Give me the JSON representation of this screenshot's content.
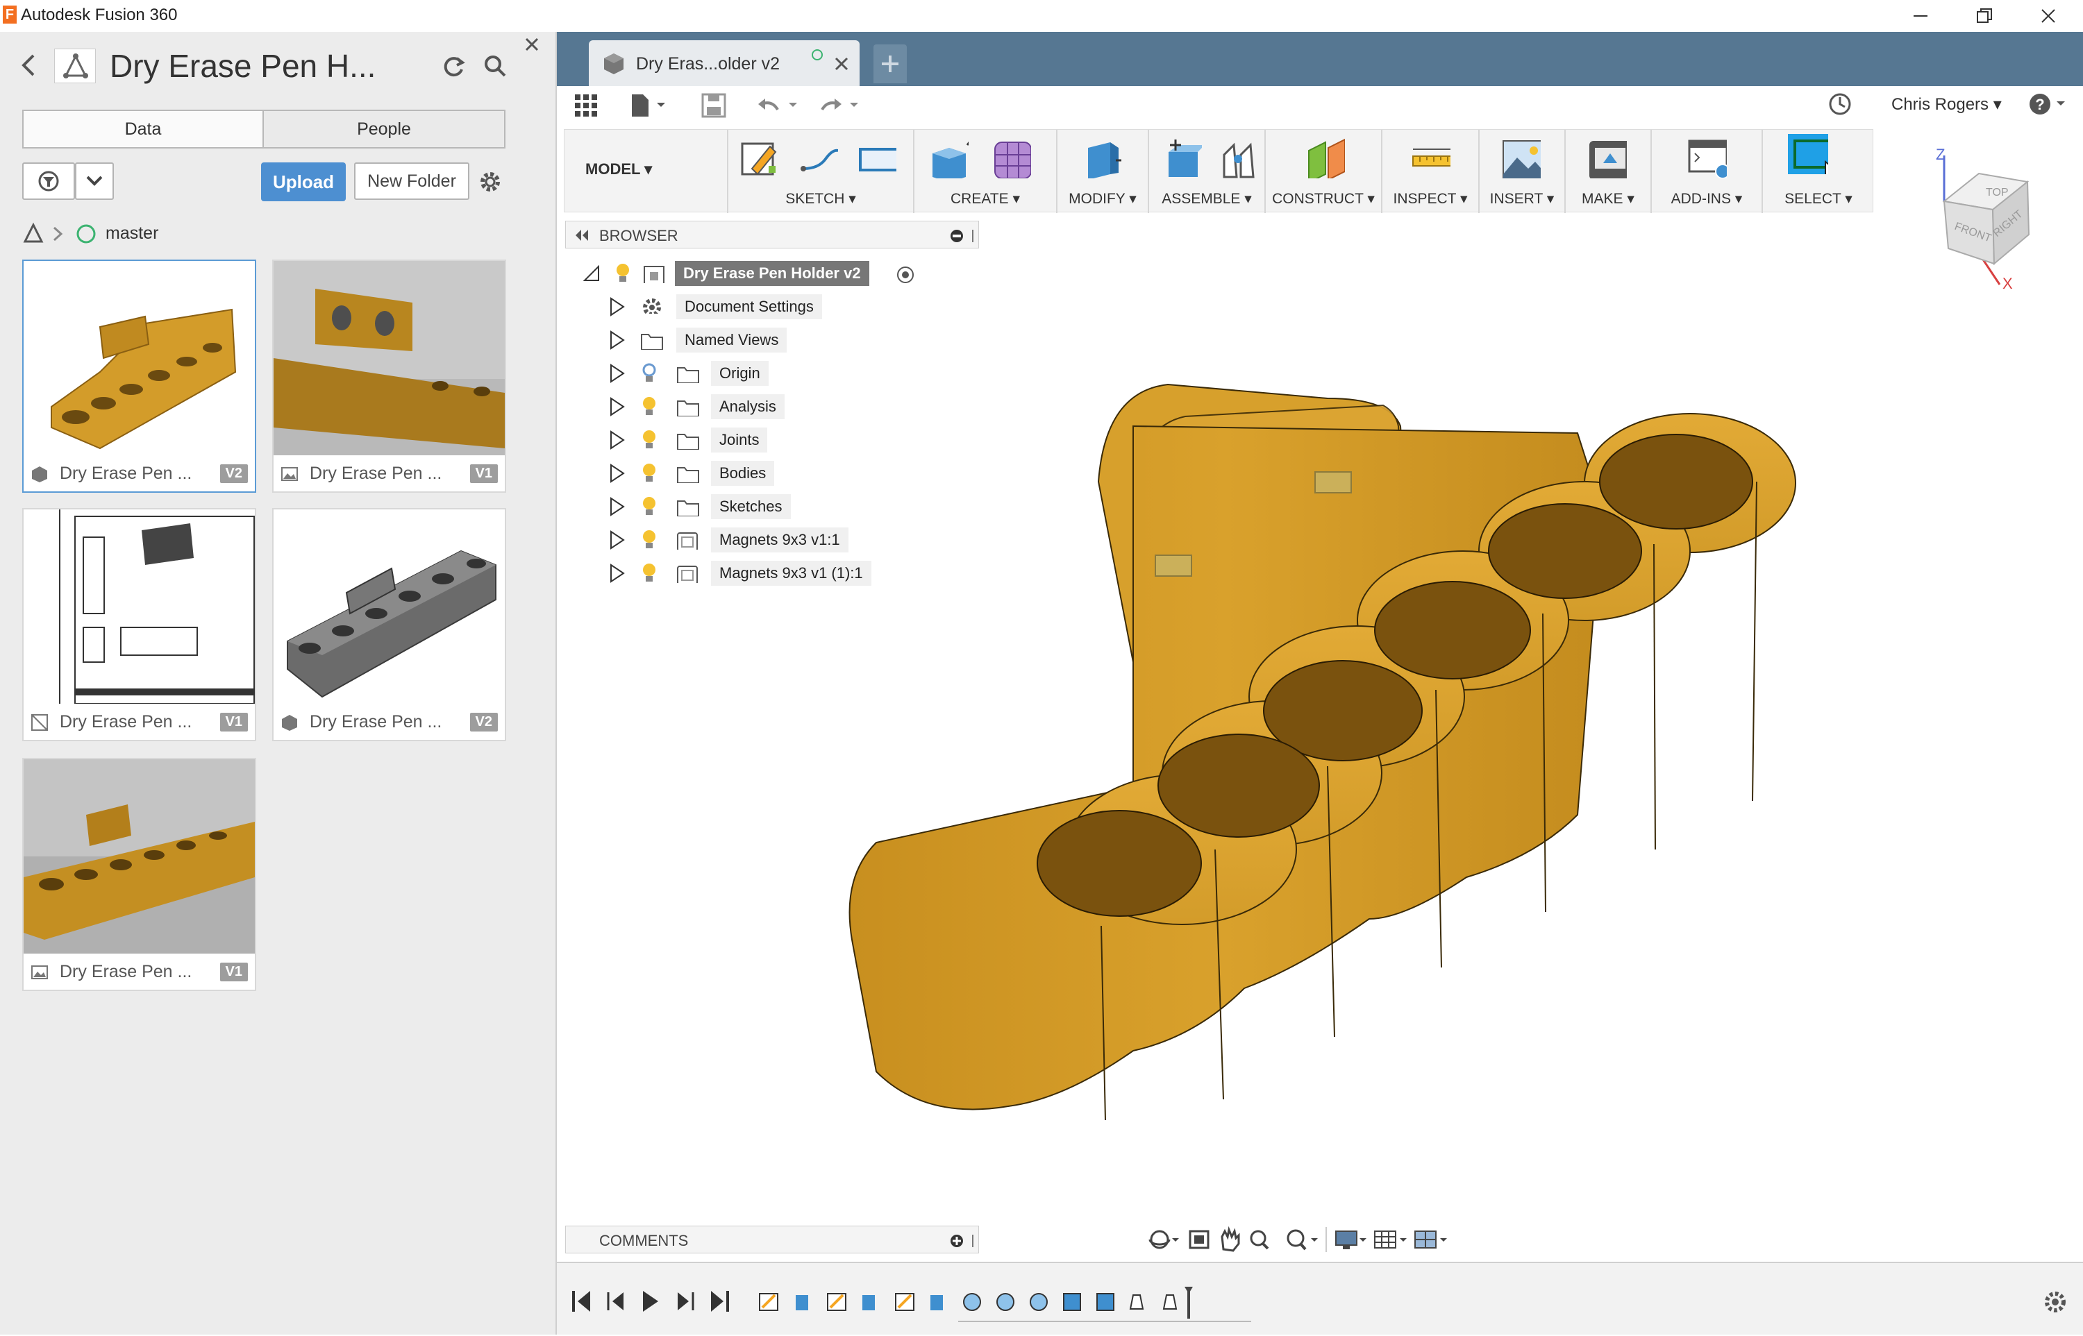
{
  "window": {
    "app_title": "Autodesk Fusion 360",
    "logo_letter": "F"
  },
  "data_panel": {
    "project_title": "Dry Erase Pen H...",
    "tabs": [
      "Data",
      "People"
    ],
    "upload_label": "Upload",
    "new_folder_label": "New Folder",
    "branch": "master",
    "files": [
      {
        "name": "Dry Erase Pen ...",
        "version": "V2",
        "type": "design"
      },
      {
        "name": "Dry Erase Pen ...",
        "version": "V1",
        "type": "image"
      },
      {
        "name": "Dry Erase Pen ...",
        "version": "V1",
        "type": "drawing"
      },
      {
        "name": "Dry Erase Pen ...",
        "version": "V2",
        "type": "design"
      },
      {
        "name": "Dry Erase Pen ...",
        "version": "V1",
        "type": "image"
      }
    ]
  },
  "document_tab": {
    "label": "Dry Eras...older v2"
  },
  "user": {
    "name": "Chris Rogers"
  },
  "ribbon": {
    "workspace": "MODEL",
    "groups": [
      "SKETCH",
      "CREATE",
      "MODIFY",
      "ASSEMBLE",
      "CONSTRUCT",
      "INSPECT",
      "INSERT",
      "MAKE",
      "ADD-INS",
      "SELECT"
    ]
  },
  "browser": {
    "title": "BROWSER",
    "root": "Dry Erase Pen Holder v2",
    "items": [
      {
        "label": "Document Settings",
        "icon": "gear-icon"
      },
      {
        "label": "Named Views",
        "icon": "folder-icon"
      },
      {
        "label": "Origin",
        "icon": "folder-icon",
        "bulb": true
      },
      {
        "label": "Analysis",
        "icon": "folder-icon",
        "bulb": true
      },
      {
        "label": "Joints",
        "icon": "folder-icon",
        "bulb": true
      },
      {
        "label": "Bodies",
        "icon": "folder-icon",
        "bulb": true
      },
      {
        "label": "Sketches",
        "icon": "folder-icon",
        "bulb": true
      },
      {
        "label": "Magnets 9x3 v1:1",
        "icon": "component-icon",
        "bulb": true
      },
      {
        "label": "Magnets 9x3 v1 (1):1",
        "icon": "component-icon",
        "bulb": true
      }
    ]
  },
  "viewcube": {
    "faces": [
      "TOP",
      "FRONT",
      "RIGHT"
    ],
    "axes": [
      "Z",
      "X"
    ]
  },
  "comments": {
    "title": "COMMENTS"
  },
  "colors": {
    "model": "#d39c2a",
    "tab_bar": "#567792",
    "accent": "#4d8fd1",
    "select_active": "#1fa0e6"
  }
}
